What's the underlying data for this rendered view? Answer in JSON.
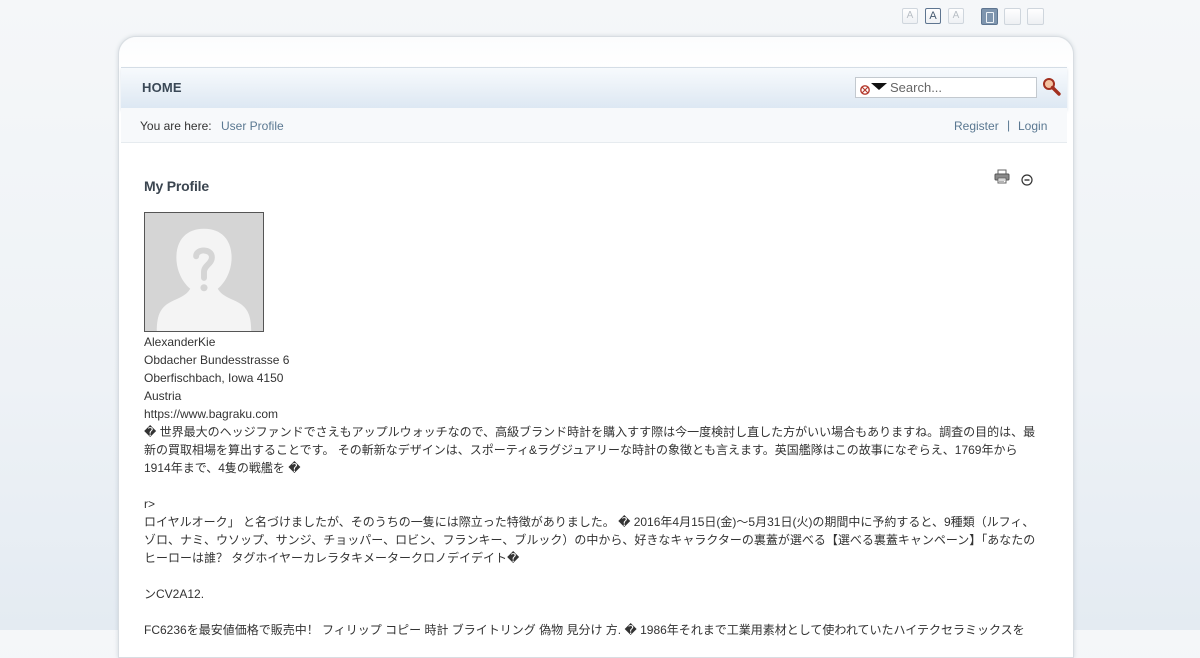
{
  "toolbar": {
    "font_small": "A",
    "font_medium": "A",
    "font_large": "A"
  },
  "nav": {
    "home": "HOME"
  },
  "search": {
    "placeholder": "Search..."
  },
  "breadcrumb": {
    "prefix": "You are here:",
    "current": "User Profile"
  },
  "auth": {
    "register": "Register",
    "separator": "|",
    "login": "Login"
  },
  "profile": {
    "title": "My Profile",
    "name": "AlexanderKie",
    "address_line1": "Obdacher Bundesstrasse 6",
    "address_line2": "Oberfischbach, Iowa 4150",
    "country": "Austria",
    "website": "https://www.bagraku.com",
    "bio": [
      "� 世界最大のヘッジファンドでさえもアップルウォッチなので、高級ブランド時計を購入すす際は今一度検討し直した方がいい場合もありますね。調査の目的は、最新の買取相場を算出することです。 その斬新なデザインは、スポーティ&ラグジュアリーな時計の象徴とも言えます。英国艦隊はこの故事になぞらえ、1769年から1914年まで、4隻の戦艦を �",
      "",
      "r>",
      "ロイヤルオーク」 と名づけましたが、そのうちの一隻には際立った特徴がありました。 � 2016年4月15日(金)～5月31日(火)の期間中に予約すると、9種類（ルフィ、ゾロ、ナミ、ウソップ、サンジ、チョッパー、ロビン、フランキー、ブルック）の中から、好きなキャラクターの裏蓋が選べる【選べる裏蓋キャンペーン】「あなたのヒーローは誰？ タグホイヤーカレラタキメータークロノデイデイト�",
      "",
      "ンCV2A12.",
      "",
      "FC6236を最安値価格で販売中！ フィリップ コピー 時計 ブライトリング 偽物 見分け 方. � 1986年それまで工業用素材として使われていたハイテクセラミックスを"
    ]
  },
  "colors": {
    "link": "#5a7891",
    "nav_text": "#3a4856",
    "frame_border": "#d8dde2"
  }
}
